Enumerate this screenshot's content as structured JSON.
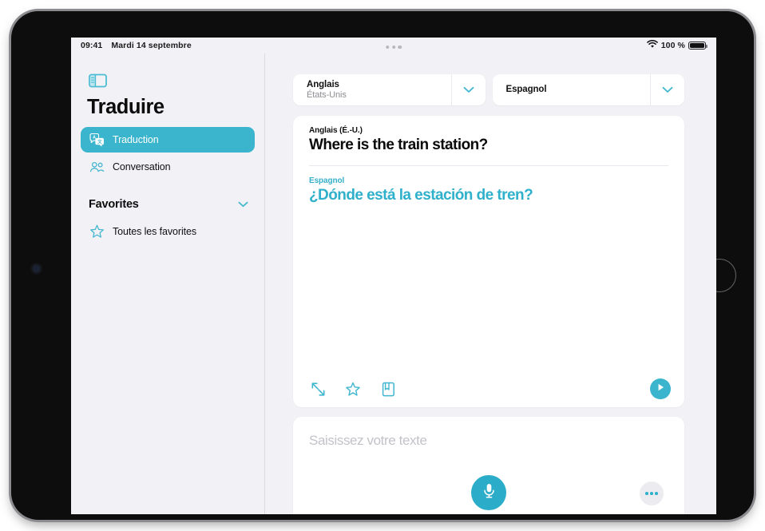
{
  "status_bar": {
    "time": "09:41",
    "date": "Mardi 14 septembre",
    "wifi_icon": "wifi-icon",
    "battery_percent": "100 %",
    "battery_icon": "battery-full-icon"
  },
  "multitask_control": {
    "icon": "multitask-dots-icon"
  },
  "sidebar": {
    "toggle_icon": "sidebar-toggle-icon",
    "title": "Traduire",
    "items": [
      {
        "label": "Traduction",
        "icon": "translate-bubbles-icon",
        "selected": true
      },
      {
        "label": "Conversation",
        "icon": "two-people-icon",
        "selected": false
      }
    ],
    "section": {
      "label": "Favorites",
      "chevron_icon": "chevron-down-icon",
      "items": [
        {
          "label": "Toutes les favorites",
          "icon": "star-outline-icon"
        }
      ]
    }
  },
  "main": {
    "source_selector": {
      "language": "Anglais",
      "region": "États-Unis",
      "chevron_icon": "chevron-down-icon"
    },
    "target_selector": {
      "language": "Espagnol",
      "chevron_icon": "chevron-down-icon"
    },
    "translation_card": {
      "source_label": "Anglais (É.-U.)",
      "source_text": "Where is the train station?",
      "target_label": "Espagnol",
      "target_text": "¿Dónde está la estación de tren?",
      "tools": [
        {
          "name": "expand-icon",
          "label": "Plein écran"
        },
        {
          "name": "star-outline-icon",
          "label": "Favori"
        },
        {
          "name": "dictionary-book-icon",
          "label": "Dictionnaire"
        }
      ],
      "play_icon": "play-icon"
    },
    "input_card": {
      "placeholder": "Saisissez votre texte",
      "value": "",
      "mic_icon": "microphone-icon",
      "more_icon": "ellipsis-icon"
    }
  },
  "colors": {
    "accent": "#3bb4cd",
    "accent_text": "#2fb0cb",
    "background": "#f2f1f6",
    "card": "#ffffff",
    "placeholder": "#c3c2c9"
  }
}
